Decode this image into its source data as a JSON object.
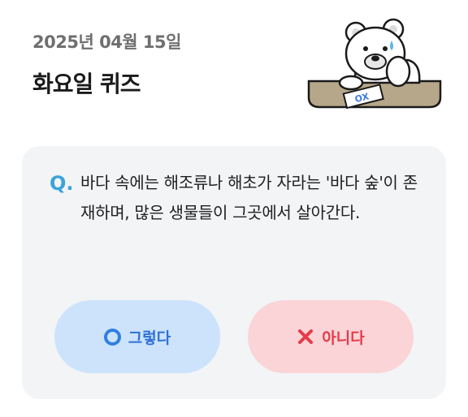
{
  "header": {
    "date": "2025년 04월 15일",
    "title": "화요일 퀴즈"
  },
  "illustration": {
    "card_text": "OX"
  },
  "quiz": {
    "q_marker": "Q.",
    "question": "바다 속에는 해조류나 해초가 자라는 '바다 숲'이 존재하며, 많은 생물들이 그곳에서 살아간다."
  },
  "answers": {
    "yes_label": "그렇다",
    "no_label": "아니다"
  },
  "colors": {
    "accent_blue": "#3da3d9",
    "yes_bg": "#cde3fb",
    "no_bg": "#fbd4d8",
    "no_text": "#e63a48"
  }
}
